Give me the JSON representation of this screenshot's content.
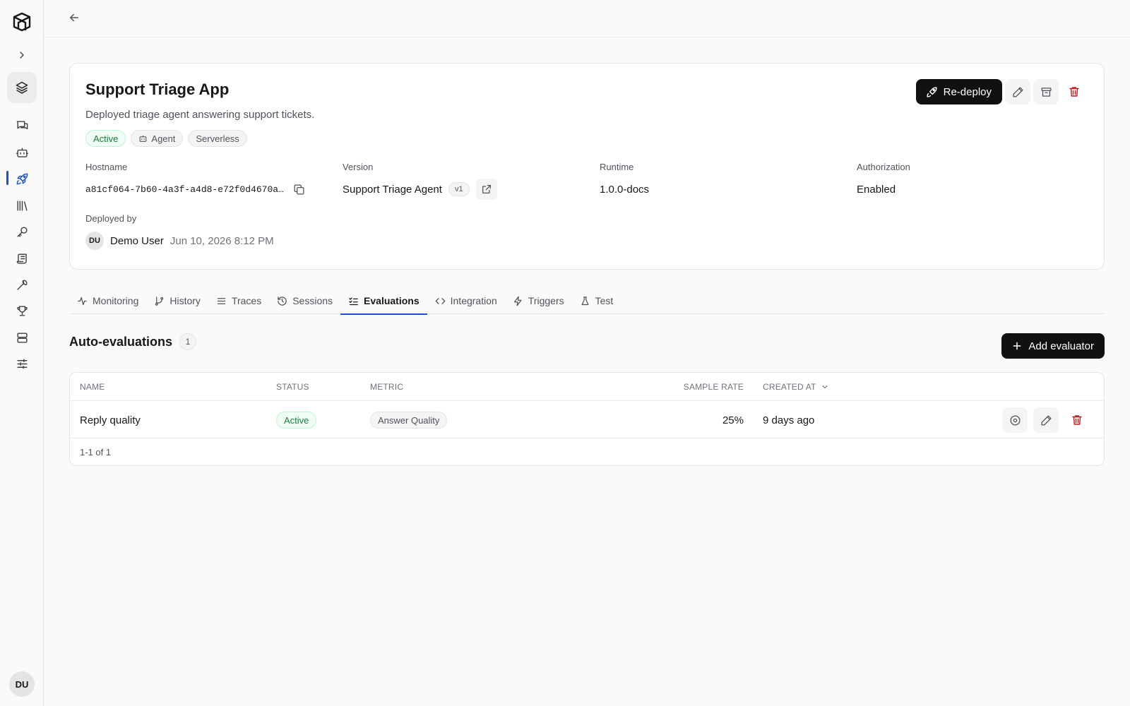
{
  "sidebar": {
    "avatar_initials": "DU",
    "items": [
      {
        "icon": "layers-icon"
      },
      {
        "icon": "chat-icon"
      },
      {
        "icon": "bot-icon"
      },
      {
        "icon": "rocket-icon"
      },
      {
        "icon": "library-icon"
      },
      {
        "icon": "key-icon"
      },
      {
        "icon": "scroll-icon"
      },
      {
        "icon": "wrench-icon"
      },
      {
        "icon": "trophy-icon"
      },
      {
        "icon": "server-icon"
      },
      {
        "icon": "sliders-icon"
      }
    ]
  },
  "app": {
    "title": "Support Triage App",
    "description": "Deployed triage agent answering support tickets.",
    "badges": {
      "status": "Active",
      "type": "Agent",
      "mode": "Serverless"
    },
    "redeploy_label": "Re-deploy",
    "fields": {
      "hostname_label": "Hostname",
      "hostname_value": "a81cf064-7b60-4a3f-a4d8-e72f0d4670a…",
      "version_label": "Version",
      "version_value": "Support Triage Agent",
      "version_tag": "v1",
      "runtime_label": "Runtime",
      "runtime_value": "1.0.0-docs",
      "auth_label": "Authorization",
      "auth_value": "Enabled",
      "deployed_by_label": "Deployed by",
      "deployer_initials": "DU",
      "deployer_name": "Demo User",
      "deployed_at": "Jun 10, 2026 8:12 PM"
    }
  },
  "tabs": [
    "Monitoring",
    "History",
    "Traces",
    "Sessions",
    "Evaluations",
    "Integration",
    "Triggers",
    "Test"
  ],
  "active_tab": "Evaluations",
  "evaluations": {
    "title": "Auto-evaluations",
    "count": "1",
    "add_label": "Add evaluator",
    "columns": {
      "name": "NAME",
      "status": "STATUS",
      "metric": "METRIC",
      "sample_rate": "SAMPLE RATE",
      "created_at": "CREATED AT"
    },
    "rows": [
      {
        "name": "Reply quality",
        "status": "Active",
        "metric": "Answer Quality",
        "sample_rate": "25%",
        "created_at": "9 days ago"
      }
    ],
    "pagination": "1-1 of 1"
  },
  "colors": {
    "accent": "#1d4ed8",
    "primary_button": "#111113",
    "success": "#15803d",
    "danger": "#b91c1c"
  }
}
